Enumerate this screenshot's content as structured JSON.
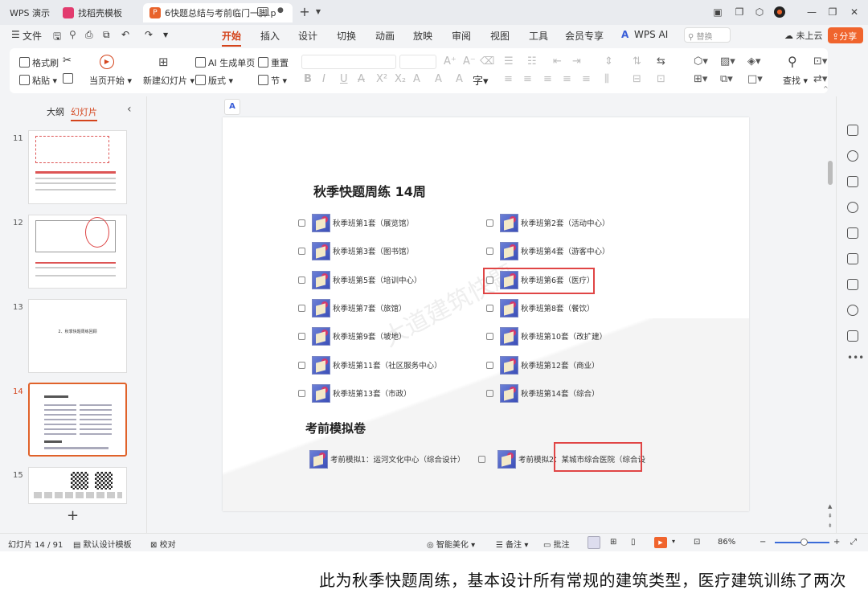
{
  "tabs": [
    {
      "label": "WPS 演示"
    },
    {
      "label": "找稻壳模板"
    },
    {
      "label": "6快题总结与考前临门一脚.p"
    }
  ],
  "menu": [
    "文件",
    "开始",
    "插入",
    "设计",
    "切换",
    "动画",
    "放映",
    "审阅",
    "视图",
    "工具",
    "会员专享",
    "WPS AI"
  ],
  "menu_active": "开始",
  "search_placeholder": "替换",
  "cloud_label": "未上云",
  "share_label": "分享",
  "ribbon": {
    "format_painter": "格式刷",
    "paste": "粘贴",
    "play_from_start": "当页开始",
    "new_slide": "新建幻灯片",
    "ai_single": "AI 生成单页",
    "layout": "版式",
    "reset": "重置",
    "section": "节",
    "find": "查找"
  },
  "panel_tabs": {
    "outline": "大纲",
    "slides": "幻灯片"
  },
  "thumbs": [
    {
      "num": "11"
    },
    {
      "num": "12"
    },
    {
      "num": "13",
      "text": "2、秋季快题周练回顾"
    },
    {
      "num": "14"
    },
    {
      "num": "15"
    }
  ],
  "slide": {
    "title": "秋季快题周练  14周",
    "left_items": [
      "秋季班第1套（展览馆）",
      "秋季班第3套（图书馆）",
      "秋季班第5套（培训中心）",
      "秋季班第7套（旅馆）",
      "秋季班第9套（坡地）",
      "秋季班第11套（社区服务中心）",
      "秋季班第13套（市政）"
    ],
    "right_items": [
      "秋季班第2套（活动中心）",
      "秋季班第4套（游客中心）",
      "秋季班第6套（医疗）",
      "秋季班第8套（餐饮）",
      "秋季班第10套（改扩建）",
      "秋季班第12套（商业）",
      "秋季班第14套（综合）"
    ],
    "section_title": "考前模拟卷",
    "mock1": "考前模拟1：运河文化中心（综合设计）",
    "mock2_prefix": "考前模拟2：",
    "mock2_text": "某城市综合医院（综合设",
    "watermark": "大道建筑快题"
  },
  "status": {
    "slide_count": "幻灯片 14 / 91",
    "template": "默认设计模板",
    "proofread": "校对",
    "smart": "智能美化",
    "notes": "备注",
    "comments": "批注",
    "zoom": "86%"
  },
  "caption": "此为秋季快题周练，基本设计所有常规的建筑类型，医疗建筑训练了两次",
  "colors": {
    "accent": "#d4441c",
    "highlight": "#e04545",
    "share": "#f0642d"
  }
}
